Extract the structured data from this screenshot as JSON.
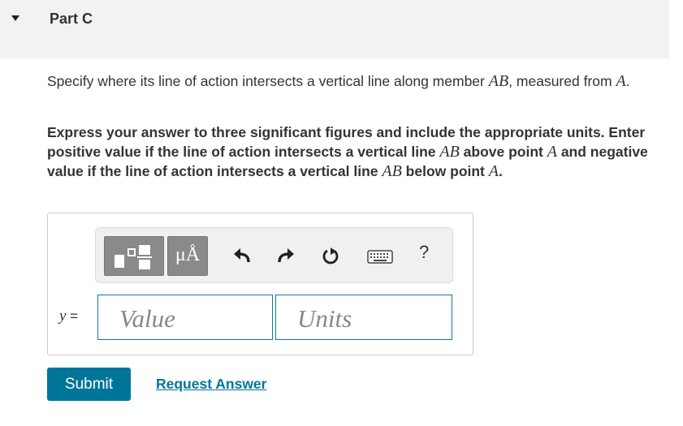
{
  "part": {
    "title": "Part C"
  },
  "question": {
    "text_1": "Specify where its line of action intersects a vertical line along member ",
    "member": "AB",
    "text_2": ", measured from ",
    "point": "A",
    "text_3": "."
  },
  "instructions": {
    "text_1": "Express your answer to three significant figures and include the appropriate units. Enter positive value if the line of action intersects a vertical line ",
    "member_1": "AB",
    "text_2": " above point ",
    "point_1": "A",
    "text_3": " and negative value if the line of action intersects a vertical line ",
    "member_2": "AB",
    "text_4": " below point ",
    "point_2": "A",
    "text_5": "."
  },
  "toolbar": {
    "templates_icon": "templates-icon",
    "units_symbol": "μÅ",
    "undo_icon": "undo-icon",
    "redo_icon": "redo-icon",
    "reset_icon": "reset-icon",
    "keyboard_icon": "keyboard-icon",
    "help_label": "?"
  },
  "answer": {
    "variable": "y",
    "equals": " =",
    "value_placeholder": "Value",
    "units_placeholder": "Units"
  },
  "actions": {
    "submit_label": "Submit",
    "request_label": "Request Answer"
  },
  "colors": {
    "accent": "#00759a",
    "header_bg": "#f2f2f2",
    "toolbar_button": "#8a8a8a"
  }
}
